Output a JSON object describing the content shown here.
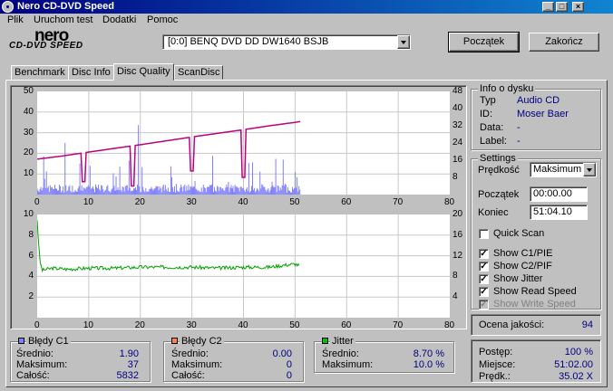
{
  "window": {
    "title": "Nero CD-DVD Speed"
  },
  "menu": [
    "Plik",
    "Uruchom test",
    "Dodatki",
    "Pomoc"
  ],
  "logo": {
    "line1": "nero",
    "line2": "CD-DVD SPEED"
  },
  "drive": {
    "value": "[0:0]  BENQ DVD DD DW1640 BSJB"
  },
  "buttons": {
    "start": "Początek",
    "exit": "Zakończ"
  },
  "tabs": [
    "Benchmark",
    "Disc Info",
    "Disc Quality",
    "ScanDisc"
  ],
  "active_tab": "Disc Quality",
  "disc_info": {
    "title": "Info o dysku",
    "rows": [
      {
        "label": "Typ",
        "value": "Audio CD"
      },
      {
        "label": "ID:",
        "value": "Moser Baer"
      },
      {
        "label": "Data:",
        "value": "-"
      },
      {
        "label": "Label:",
        "value": "-"
      }
    ]
  },
  "settings": {
    "title": "Settings",
    "speed_label": "Prędkość",
    "speed_value": "Maksimum",
    "start_label": "Początek",
    "start_value": "00:00.00",
    "end_label": "Koniec",
    "end_value": "51:04.10",
    "quick_scan": "Quick Scan",
    "checks": [
      {
        "label": "Show C1/PIE",
        "checked": true,
        "enabled": true
      },
      {
        "label": "Show C2/PIF",
        "checked": true,
        "enabled": true
      },
      {
        "label": "Show Jitter",
        "checked": true,
        "enabled": true
      },
      {
        "label": "Show Read Speed",
        "checked": true,
        "enabled": true
      },
      {
        "label": "Show Write Speed",
        "checked": true,
        "enabled": false
      }
    ]
  },
  "quality": {
    "label": "Ocena jakości:",
    "value": "94"
  },
  "progress": {
    "rows": [
      {
        "label": "Postęp:",
        "value": "100 %"
      },
      {
        "label": "Miejsce:",
        "value": "51:02.00"
      },
      {
        "label": "Prędk.:",
        "value": "35.02 X"
      }
    ]
  },
  "stats": {
    "c1": {
      "title": "Błędy C1",
      "color": "#8080ff",
      "rows": [
        {
          "label": "Średnio:",
          "value": "1.90"
        },
        {
          "label": "Maksimum:",
          "value": "37"
        },
        {
          "label": "Całość:",
          "value": "5832"
        }
      ]
    },
    "c2": {
      "title": "Błędy C2",
      "color": "#ff8040",
      "rows": [
        {
          "label": "Średnio:",
          "value": "0.00"
        },
        {
          "label": "Maksimum:",
          "value": "0"
        },
        {
          "label": "Całość:",
          "value": "0"
        }
      ]
    },
    "jitter": {
      "title": "Jitter",
      "color": "#00c000",
      "rows": [
        {
          "label": "Średnio:",
          "value": "8.70 %"
        },
        {
          "label": "Maksimum:",
          "value": "10.0 %"
        }
      ]
    }
  },
  "chart_data": [
    {
      "type": "bar",
      "name": "C1 errors and read speed",
      "x_range": [
        0,
        80
      ],
      "x_ticks": [
        0,
        10,
        20,
        30,
        40,
        50,
        60,
        70,
        80
      ],
      "y_left_range": [
        0,
        50
      ],
      "y_left_ticks": [
        10,
        20,
        30,
        40,
        50
      ],
      "y_right_range": [
        0,
        48
      ],
      "y_right_ticks": [
        8,
        16,
        24,
        32,
        40,
        48
      ],
      "colors": {
        "bars": "#8080ff",
        "speed": "#c00080"
      },
      "speed_series": {
        "x": [
          0,
          5,
          10,
          15,
          20,
          25,
          30,
          35,
          40,
          45,
          50,
          51
        ],
        "y": [
          16.5,
          18,
          19.8,
          21.5,
          23.2,
          25,
          26.8,
          28.5,
          30.2,
          32,
          33.6,
          34
        ]
      },
      "speed_dips": [
        {
          "x": 9,
          "y": 6
        },
        {
          "x": 18.5,
          "y": 4
        },
        {
          "x": 30,
          "y": 11
        },
        {
          "x": 40,
          "y": 8
        }
      ],
      "c1_bars_max": 37
    },
    {
      "type": "line",
      "name": "Jitter",
      "x_range": [
        0,
        80
      ],
      "x_ticks": [
        0,
        10,
        20,
        30,
        40,
        50,
        60,
        70,
        80
      ],
      "y_left_range": [
        0,
        10
      ],
      "y_left_ticks": [
        2,
        4,
        6,
        8,
        10
      ],
      "y_right_range": [
        0,
        20
      ],
      "y_right_ticks": [
        4,
        8,
        12,
        16,
        20
      ],
      "colors": {
        "jitter": "#00a000"
      },
      "jitter_series": {
        "x": [
          0,
          0.5,
          1,
          3,
          6,
          10,
          15,
          20,
          25,
          30,
          35,
          40,
          45,
          48,
          50,
          51
        ],
        "y": [
          9.5,
          5.5,
          4.6,
          4.8,
          4.7,
          4.8,
          4.8,
          4.9,
          4.9,
          4.9,
          4.8,
          4.9,
          4.9,
          5.1,
          5.2,
          5.0
        ]
      }
    }
  ]
}
